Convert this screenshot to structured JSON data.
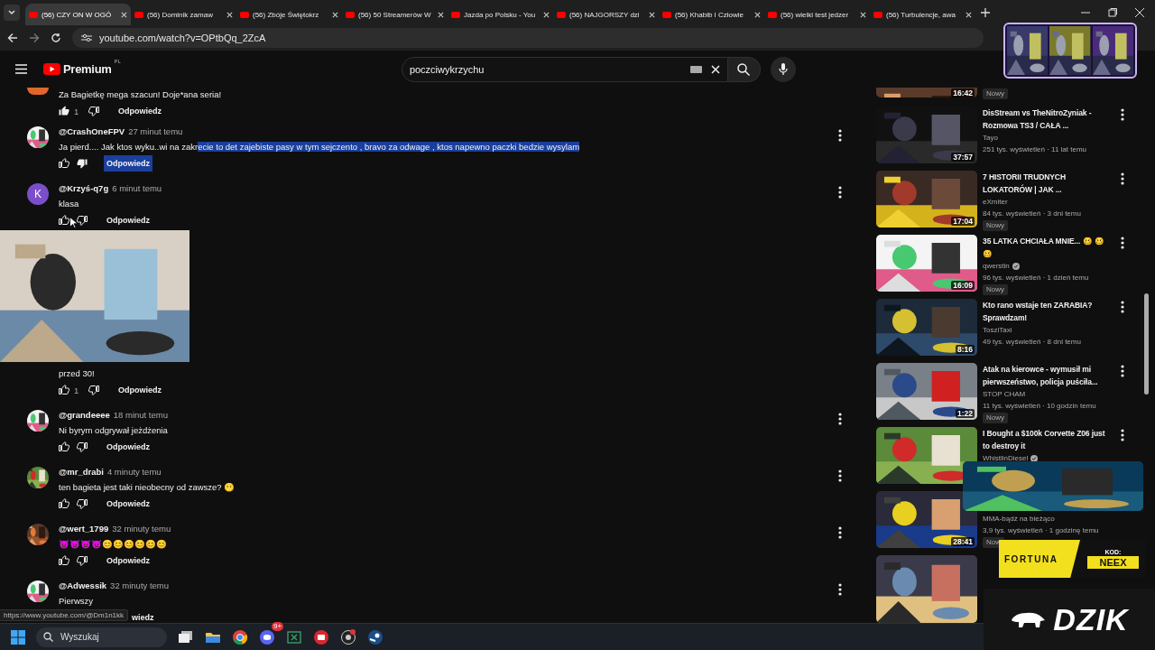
{
  "browser": {
    "tabs": [
      {
        "title": "(56) CZY ON W OGÓ",
        "selected": true
      },
      {
        "title": "(56) Dominik zamaw",
        "selected": false
      },
      {
        "title": "(56) Zbóje Świętokrz",
        "selected": false
      },
      {
        "title": "(56) 50 Streamerów W",
        "selected": false
      },
      {
        "title": "Jazda po Polsku - You",
        "selected": false
      },
      {
        "title": "(56) NAJGORSZY dzi",
        "selected": false
      },
      {
        "title": "(56) Khabib I Człowie",
        "selected": false
      },
      {
        "title": "(56) wielki test jedzer",
        "selected": false
      },
      {
        "title": "(56) Turbulencje, awa",
        "selected": false
      }
    ],
    "url": "youtube.com/watch?v=OPtbQq_2ZcA"
  },
  "header": {
    "logo": "Premium",
    "region": "PL",
    "search": "poczciwykrzychu"
  },
  "comments": [
    {
      "kind": "cut",
      "color": "#e0662a",
      "parts": [
        {
          "text": "Za Bagietkę mega szacun! Doje*ana seria!",
          "selected": false
        }
      ],
      "likes": "1",
      "liked": true,
      "disliked": false,
      "reply": "Odpowiedz",
      "reply_selected": false
    },
    {
      "kind": "full",
      "author": "@CrashOneFPV",
      "time": "27 minut temu",
      "parts": [
        {
          "text": "Ja pierd.... Jak ktos wyku..wi na zakr",
          "selected": false
        },
        {
          "text": "ecie to det zajebiste pasy w tym sejczento , bravo za odwage , ktos napewno paczki bedzie wysylam",
          "selected": true
        }
      ],
      "liked": false,
      "disliked": true,
      "reply": "Odpowiedz",
      "reply_selected": true
    },
    {
      "kind": "full",
      "letter": "K",
      "color": "#7b4fc9",
      "author": "@Krzyś-q7g",
      "time": "6 minut temu",
      "parts": [
        {
          "text": "klasa",
          "selected": false
        }
      ],
      "liked": false,
      "disliked": false,
      "reply": "Odpowiedz",
      "reply_selected": false
    },
    {
      "kind": "covered",
      "parts": [
        {
          "text": "przed 30!",
          "selected": false
        }
      ],
      "likes": "1",
      "liked": false,
      "disliked": false,
      "reply": "Odpowiedz",
      "reply_selected": false
    },
    {
      "kind": "full",
      "author": "@grandeeee",
      "time": "18 minut temu",
      "parts": [
        {
          "text": "Ni byrym odgrywał jeżdżenia",
          "selected": false
        }
      ],
      "liked": false,
      "disliked": false,
      "reply": "Odpowiedz",
      "reply_selected": false
    },
    {
      "kind": "full",
      "author": "@mr_drabi",
      "time": "4 minuty temu",
      "parts": [
        {
          "text": "ten bagieta jest taki nieobecny od zawsze? 😶",
          "selected": false
        }
      ],
      "liked": false,
      "disliked": false,
      "reply": "Odpowiedz",
      "reply_selected": false
    },
    {
      "kind": "full",
      "author": "@wert_1799",
      "time": "32 minuty temu",
      "parts": [
        {
          "text": "😈😈😈😈😊😊😊😊😊😊",
          "selected": false
        }
      ],
      "liked": false,
      "disliked": false,
      "reply": "Odpowiedz",
      "reply_selected": false
    },
    {
      "kind": "full",
      "author": "@Adwessik",
      "time": "32 minuty temu",
      "parts": [
        {
          "text": "Pierwszy",
          "selected": false
        }
      ],
      "reply": "wiedz",
      "reply_selected": false
    }
  ],
  "status_url": "https://www.youtube.com/@Dm1n1kk",
  "sidebar": [
    {
      "kind": "cut",
      "duration": "16:42",
      "badge": "Nowy"
    },
    {
      "kind": "full",
      "title": "DisStream vs TheNitroZyniak - Rozmowa TS3 / CAŁA ...",
      "channel": "Tayo",
      "verified": false,
      "meta": "251 tys. wyświetleń · 11 lat temu",
      "duration": "37:57"
    },
    {
      "kind": "full",
      "title": "7 HISTORII TRUDNYCH LOKATORÓW | JAK ...",
      "channel": "eXmiter",
      "verified": false,
      "meta": "84 tys. wyświetleń · 3 dni temu",
      "badge": "Nowy",
      "duration": "17:04"
    },
    {
      "kind": "full",
      "title": "35 LATKA CHCIAŁA MNIE... 🥴 🥴🥴",
      "channel": "qwerstin",
      "verified": true,
      "meta": "96 tys. wyświetleń · 1 dzień temu",
      "badge": "Nowy",
      "duration": "16:09"
    },
    {
      "kind": "full",
      "title": "Kto rano wstaje ten ZARABIA? Sprawdzam!",
      "channel": "TosziTaxi",
      "verified": false,
      "meta": "49 tys. wyświetleń · 8 dni temu",
      "duration": "8:16"
    },
    {
      "kind": "full",
      "title": "Atak na kierowce - wymusił mi pierwszeństwo, policja puściła...",
      "channel": "STOP CHAM",
      "verified": false,
      "meta": "11 tys. wyświetleń · 10 godzin temu",
      "badge": "Nowy",
      "duration": "1:22"
    },
    {
      "kind": "full",
      "title": "I Bought a $100k Corvette Z06 just to destroy it",
      "channel": "WhistlinDiesel",
      "verified": true
    },
    {
      "kind": "covered",
      "channel": "MMA-bądź na bieżąco",
      "meta": "3,9 tys. wyświetleń · 1 godzinę temu",
      "badge": "Now",
      "duration": "28:41"
    },
    {
      "kind": "thumb"
    }
  ],
  "ads": {
    "fortuna": "FORTUNA",
    "code_label": "KOD:",
    "code": "NEEX",
    "brand": "DZIK"
  },
  "taskbar": {
    "search": "Wyszukaj",
    "badge": "9+"
  }
}
